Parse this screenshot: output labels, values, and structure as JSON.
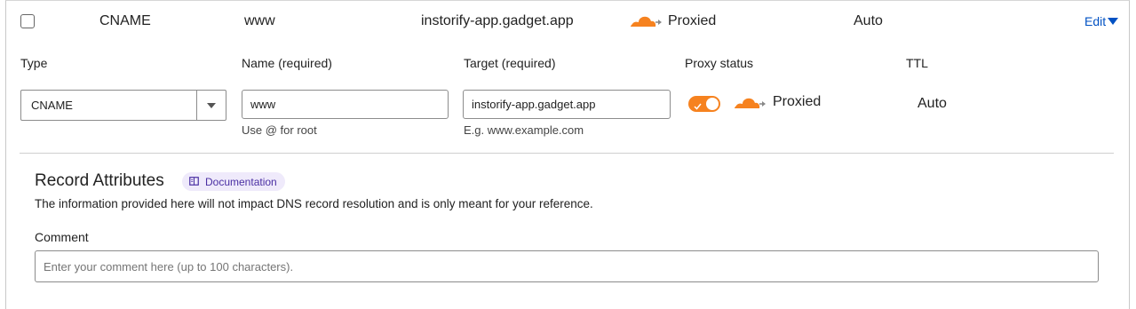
{
  "record_row": {
    "type": "CNAME",
    "name": "www",
    "target": "instorify-app.gadget.app",
    "proxy_status": "Proxied",
    "ttl": "Auto",
    "edit_label": "Edit"
  },
  "form": {
    "type_label": "Type",
    "type_value": "CNAME",
    "name_label": "Name (required)",
    "name_value": "www",
    "name_hint": "Use @ for root",
    "target_label": "Target (required)",
    "target_value": "instorify-app.gadget.app",
    "target_hint": "E.g. www.example.com",
    "proxy_label": "Proxy status",
    "proxy_value": "Proxied",
    "proxy_enabled": true,
    "ttl_label": "TTL",
    "ttl_value": "Auto"
  },
  "attributes": {
    "title": "Record Attributes",
    "doc_badge": "Documentation",
    "description": "The information provided here will not impact DNS record resolution and is only meant for your reference.",
    "comment_label": "Comment",
    "comment_placeholder": "Enter your comment here (up to 100 characters)."
  },
  "colors": {
    "accent_orange": "#f6821f",
    "link_blue": "#0051c3",
    "badge_bg": "#efeafb",
    "badge_text": "#4a2fa3"
  },
  "icons": [
    "cloud-icon",
    "chevron-down-icon",
    "caret-down-icon",
    "book-icon",
    "check-icon"
  ]
}
